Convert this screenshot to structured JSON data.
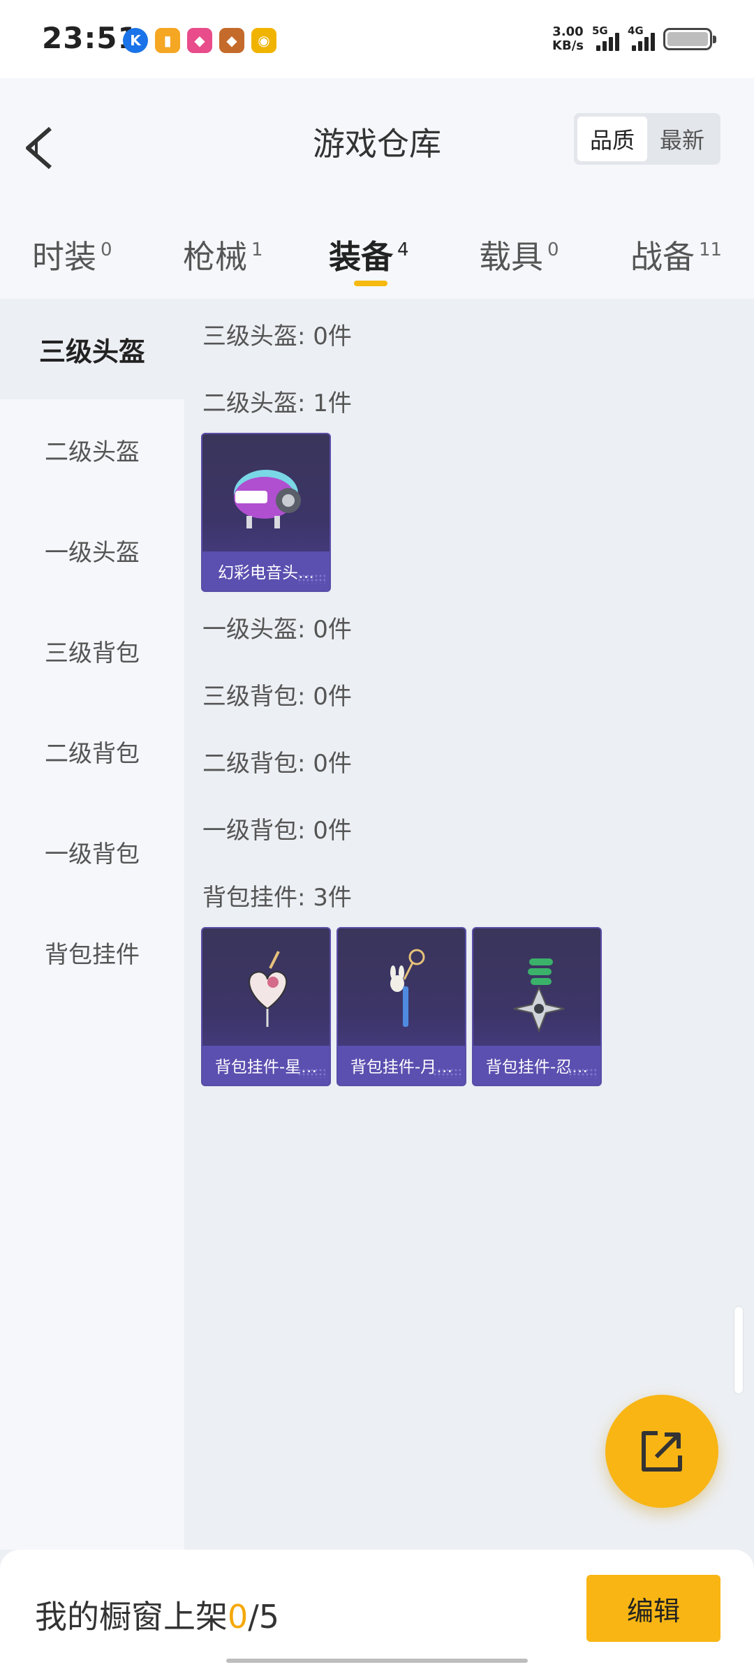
{
  "status_bar": {
    "time": "23:51",
    "net_speed_value": "3.00",
    "net_speed_unit": "KB/s",
    "signal1_label": "5G",
    "signal2_label": "4G",
    "app_icons": [
      "k-icon",
      "notes-icon",
      "app-icon",
      "app-icon",
      "weibo-icon"
    ]
  },
  "header": {
    "title": "游戏仓库",
    "sort_quality": "品质",
    "sort_latest": "最新"
  },
  "tabs": [
    {
      "label": "时装",
      "count": "0"
    },
    {
      "label": "枪械",
      "count": "1"
    },
    {
      "label": "装备",
      "count": "4"
    },
    {
      "label": "载具",
      "count": "0"
    },
    {
      "label": "战备",
      "count": "11"
    }
  ],
  "sidebar": {
    "items": [
      "三级头盔",
      "二级头盔",
      "一级头盔",
      "三级背包",
      "二级背包",
      "一级背包",
      "背包挂件"
    ]
  },
  "sections": [
    {
      "label": "三级头盔: 0件"
    },
    {
      "label": "二级头盔: 1件",
      "items": [
        {
          "name": "幻彩电音头…"
        }
      ]
    },
    {
      "label": "一级头盔: 0件"
    },
    {
      "label": "三级背包: 0件"
    },
    {
      "label": "二级背包: 0件"
    },
    {
      "label": "一级背包: 0件"
    },
    {
      "label": "背包挂件: 3件",
      "items": [
        {
          "name": "背包挂件-星…"
        },
        {
          "name": "背包挂件-月…"
        },
        {
          "name": "背包挂件-忍…"
        }
      ]
    }
  ],
  "footer": {
    "label": "我的橱窗上架",
    "current": "0",
    "total": "/5",
    "edit_label": "编辑"
  },
  "colors": {
    "accent": "#f8b514",
    "card_footer": "#5b4fb0",
    "card_bg": "#3c3568"
  }
}
